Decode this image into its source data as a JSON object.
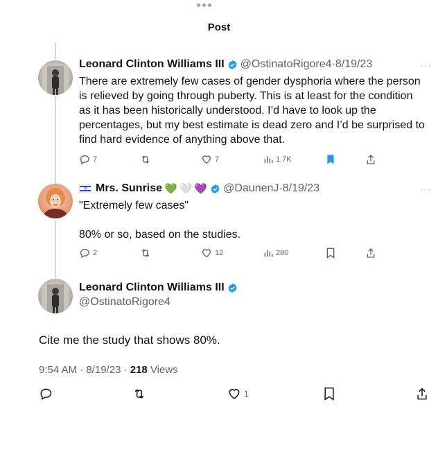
{
  "header": {
    "title": "Post"
  },
  "tweets": [
    {
      "name": "Leonard Clinton Williams III",
      "handle": "@OstinatoRigore4",
      "sep": " · ",
      "date": "8/19/23",
      "lines": [
        "There are extremely few cases of gender dysphoria where the person",
        "is relieved by going through puberty. This is at least for the condition",
        "as it has been historically understood. I’d have to look up the",
        "percentages, but my best estimate is dead zero and I’d be surprised to",
        "find hard evidence of anything above that."
      ],
      "stats": {
        "replies": "7",
        "retweets": "",
        "likes": "7",
        "views": "1.7K"
      },
      "bookmarked": true
    },
    {
      "name": "Mrs. Sunrise",
      "flag": "israel-flag",
      "hearts": [
        "💚",
        "🤍",
        "💜"
      ],
      "handle": "@DaunenJ",
      "sep": " · ",
      "date": "8/19/23",
      "lines": [
        "\"Extremely few cases\"",
        "",
        "80% or so, based on the studies."
      ],
      "stats": {
        "replies": "2",
        "retweets": "",
        "likes": "12",
        "views": "280"
      },
      "bookmarked": false
    }
  ],
  "main": {
    "name": "Leonard Clinton Williams III",
    "handle": "@OstinatoRigore4",
    "text": "Cite me the study that shows 80%.",
    "time": "9:54 AM · 8/19/23 · ",
    "views_count": "218",
    "views_label": " Views",
    "stats": {
      "likes": "1"
    }
  },
  "colors": {
    "accent": "#1d9bf0",
    "muted": "#536471",
    "text": "#0f1419",
    "line": "#cfd9de"
  }
}
